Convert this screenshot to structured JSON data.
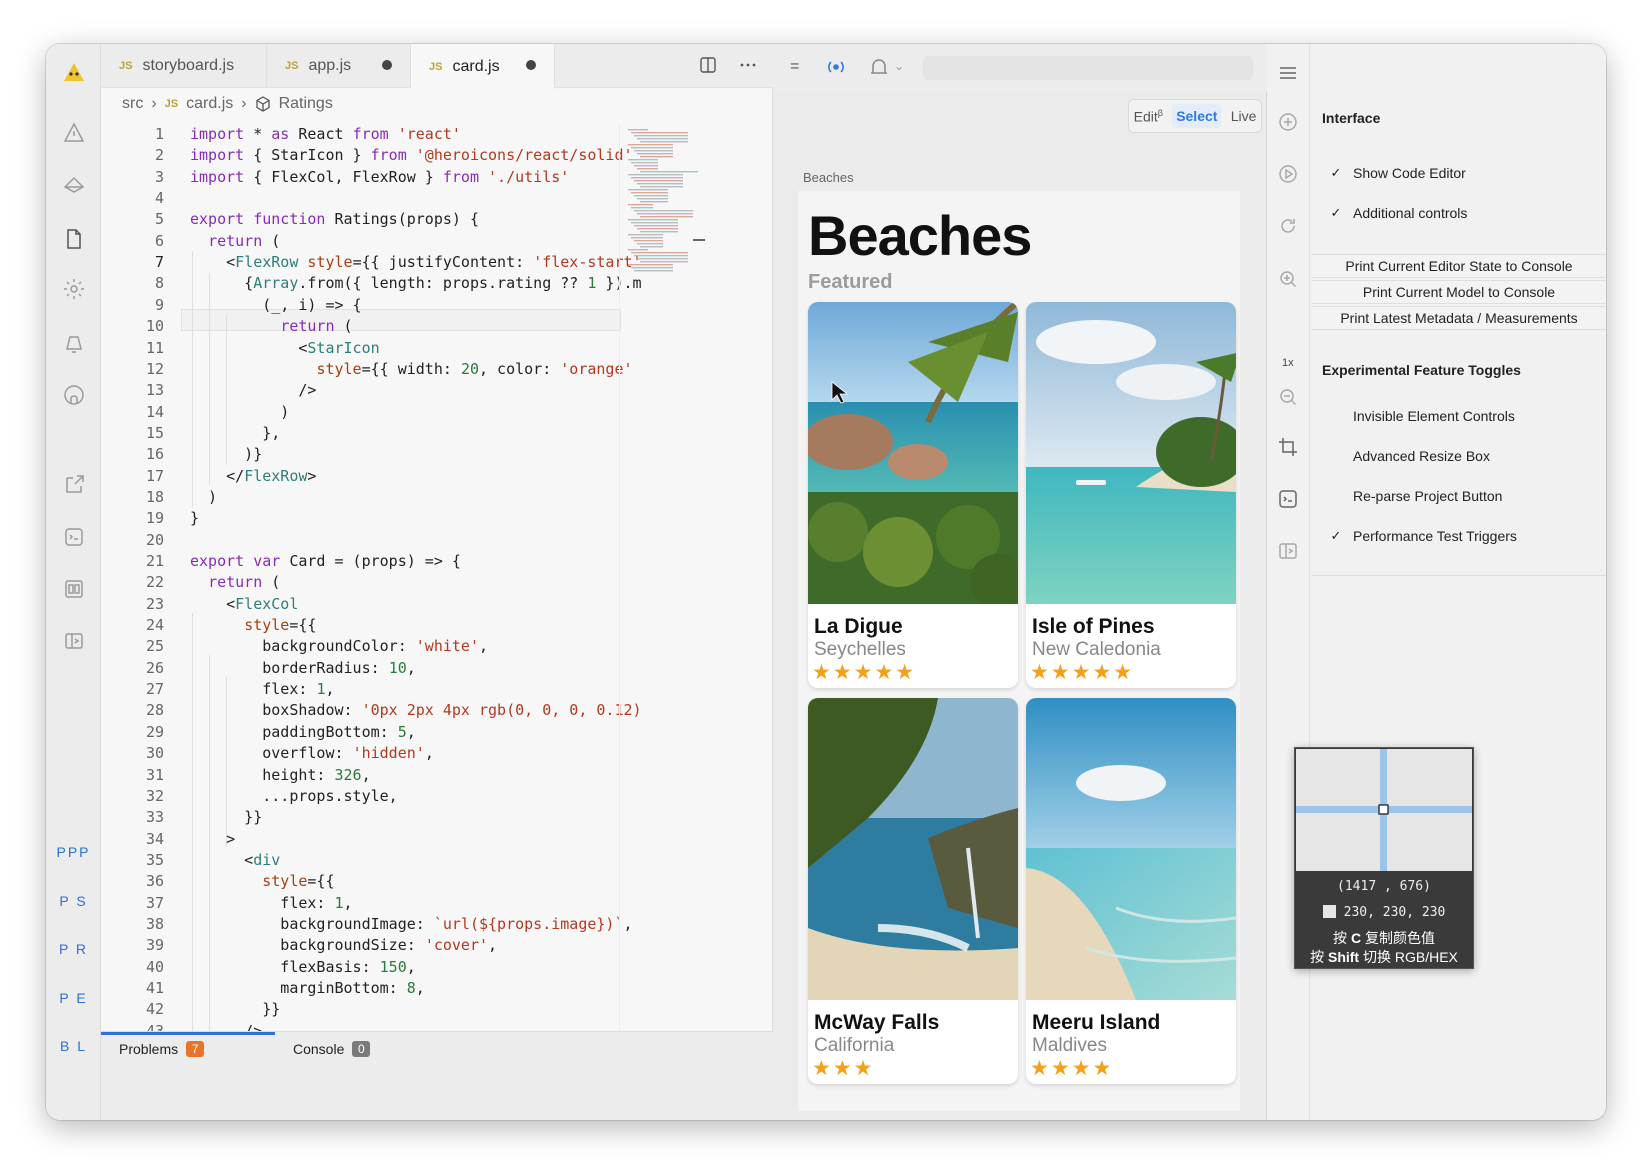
{
  "editor": {
    "tabs": [
      {
        "label": "storyboard.js",
        "badge": "JS",
        "modified": false
      },
      {
        "label": "app.js",
        "badge": "JS",
        "modified": true
      },
      {
        "label": "card.js",
        "badge": "JS",
        "modified": true,
        "active": true
      }
    ],
    "breadcrumb": {
      "folder": "src",
      "file": "card.js",
      "badge": "JS",
      "symbol": "Ratings"
    },
    "lines": [
      [
        [
          "import",
          "kw"
        ],
        [
          " * ",
          ""
        ],
        [
          "as",
          "kw"
        ],
        [
          " React ",
          ""
        ],
        [
          "from",
          "kw"
        ],
        [
          " ",
          ""
        ],
        [
          "'react'",
          "st"
        ]
      ],
      [
        [
          "import",
          "kw"
        ],
        [
          " { StarIcon } ",
          ""
        ],
        [
          "from",
          "kw"
        ],
        [
          " ",
          ""
        ],
        [
          "'@heroicons/react/solid'",
          "st"
        ]
      ],
      [
        [
          "import",
          "kw"
        ],
        [
          " { FlexCol, FlexRow } ",
          ""
        ],
        [
          "from",
          "kw"
        ],
        [
          " ",
          ""
        ],
        [
          "'./utils'",
          "st"
        ]
      ],
      [],
      [
        [
          "export",
          "kw"
        ],
        [
          " ",
          ""
        ],
        [
          "function",
          "kw"
        ],
        [
          " Ratings(props) {",
          ""
        ]
      ],
      [
        [
          "  ",
          ""
        ],
        [
          "return",
          "kw"
        ],
        [
          " (",
          ""
        ]
      ],
      [
        [
          "    <",
          ""
        ],
        [
          "FlexRow",
          "tg"
        ],
        [
          " ",
          ""
        ],
        [
          "style",
          "at"
        ],
        [
          "={{ justifyContent: ",
          ""
        ],
        [
          "'flex-start'",
          "st"
        ]
      ],
      [
        [
          "      {",
          ""
        ],
        [
          "Array",
          "tg"
        ],
        [
          ".from({ length: props.rating ?? ",
          ""
        ],
        [
          "1",
          "nm"
        ],
        [
          " }).m",
          ""
        ]
      ],
      [
        [
          "        (_, i) => {",
          ""
        ]
      ],
      [
        [
          "          ",
          ""
        ],
        [
          "return",
          "kw"
        ],
        [
          " (",
          ""
        ]
      ],
      [
        [
          "            <",
          ""
        ],
        [
          "StarIcon",
          "tg"
        ]
      ],
      [
        [
          "              ",
          ""
        ],
        [
          "style",
          "at"
        ],
        [
          "={{ width: ",
          ""
        ],
        [
          "20",
          "nm"
        ],
        [
          ", color: ",
          ""
        ],
        [
          "'orange'",
          "st"
        ]
      ],
      [
        [
          "            />",
          ""
        ]
      ],
      [
        [
          "          )",
          ""
        ]
      ],
      [
        [
          "        },",
          ""
        ]
      ],
      [
        [
          "      )}",
          ""
        ]
      ],
      [
        [
          "    </",
          ""
        ],
        [
          "FlexRow",
          "tg"
        ],
        [
          ">",
          ""
        ]
      ],
      [
        [
          "  )",
          ""
        ]
      ],
      [
        [
          "}",
          ""
        ]
      ],
      [],
      [
        [
          "export",
          "kw"
        ],
        [
          " ",
          ""
        ],
        [
          "var",
          "kw"
        ],
        [
          " Card = (props) => {",
          ""
        ]
      ],
      [
        [
          "  ",
          ""
        ],
        [
          "return",
          "kw"
        ],
        [
          " (",
          ""
        ]
      ],
      [
        [
          "    <",
          ""
        ],
        [
          "FlexCol",
          "tg"
        ]
      ],
      [
        [
          "      ",
          ""
        ],
        [
          "style",
          "at"
        ],
        [
          "={{",
          ""
        ]
      ],
      [
        [
          "        backgroundColor: ",
          ""
        ],
        [
          "'white'",
          "st"
        ],
        [
          ",",
          ""
        ]
      ],
      [
        [
          "        borderRadius: ",
          ""
        ],
        [
          "10",
          "nm"
        ],
        [
          ",",
          ""
        ]
      ],
      [
        [
          "        flex: ",
          ""
        ],
        [
          "1",
          "nm"
        ],
        [
          ",",
          ""
        ]
      ],
      [
        [
          "        boxShadow: ",
          ""
        ],
        [
          "'0px 2px 4px rgb(0, 0, 0, 0.12)",
          "st"
        ]
      ],
      [
        [
          "        paddingBottom: ",
          ""
        ],
        [
          "5",
          "nm"
        ],
        [
          ",",
          ""
        ]
      ],
      [
        [
          "        overflow: ",
          ""
        ],
        [
          "'hidden'",
          "st"
        ],
        [
          ",",
          ""
        ]
      ],
      [
        [
          "        height: ",
          ""
        ],
        [
          "326",
          "nm"
        ],
        [
          ",",
          ""
        ]
      ],
      [
        [
          "        ...props.style,",
          ""
        ]
      ],
      [
        [
          "      }}",
          ""
        ]
      ],
      [
        [
          "    >",
          ""
        ]
      ],
      [
        [
          "      <",
          ""
        ],
        [
          "div",
          "tg"
        ]
      ],
      [
        [
          "        ",
          ""
        ],
        [
          "style",
          "at"
        ],
        [
          "={{",
          ""
        ]
      ],
      [
        [
          "          flex: ",
          ""
        ],
        [
          "1",
          "nm"
        ],
        [
          ",",
          ""
        ]
      ],
      [
        [
          "          backgroundImage: ",
          ""
        ],
        [
          "`url(${props.image})`",
          "st"
        ],
        [
          ",",
          ""
        ]
      ],
      [
        [
          "          backgroundSize: ",
          ""
        ],
        [
          "'cover'",
          "st"
        ],
        [
          ",",
          ""
        ]
      ],
      [
        [
          "          flexBasis: ",
          ""
        ],
        [
          "150",
          "nm"
        ],
        [
          ",",
          ""
        ]
      ],
      [
        [
          "          marginBottom: ",
          ""
        ],
        [
          "8",
          "nm"
        ],
        [
          ",",
          ""
        ]
      ],
      [
        [
          "        }}",
          ""
        ]
      ],
      [
        [
          "      />",
          ""
        ]
      ]
    ],
    "panel": {
      "problems_label": "Problems",
      "problems_count": "7",
      "console_label": "Console",
      "console_count": "0"
    }
  },
  "activity": {
    "labels": [
      "PPP",
      "P S",
      "P R",
      "P E",
      "B L"
    ]
  },
  "canvas": {
    "modes": {
      "edit": "Edit",
      "edit_sup": "β",
      "select": "Select",
      "live": "Live"
    },
    "scene_label": "Beaches",
    "title": "Beaches",
    "subtitle": "Featured",
    "cards": [
      {
        "name": "La Digue",
        "location": "Seychelles",
        "rating": 5,
        "stars": "★★★★★"
      },
      {
        "name": "Isle of Pines",
        "location": "New Caledonia",
        "rating": 5,
        "stars": "★★★★★"
      },
      {
        "name": "McWay Falls",
        "location": "California",
        "rating": 3,
        "stars": "★★★"
      },
      {
        "name": "Meeru Island",
        "location": "Maldives",
        "rating": 4,
        "stars": "★★★★"
      }
    ]
  },
  "inspector": {
    "heading": "Interface",
    "toggles": [
      {
        "label": "Show Code Editor",
        "checked": true,
        "mark": "✓"
      },
      {
        "label": "Additional controls",
        "checked": true,
        "mark": "✓"
      }
    ],
    "buttons": [
      "Print Current Editor State to Console",
      "Print Current Model to Console",
      "Print Latest Metadata / Measurements"
    ],
    "zoom_label": "1x",
    "experimental_heading": "Experimental Feature Toggles",
    "experimental": [
      {
        "label": "Invisible Element Controls",
        "checked": false,
        "mark": ""
      },
      {
        "label": "Advanced Resize Box",
        "checked": false,
        "mark": ""
      },
      {
        "label": "Re-parse Project Button",
        "checked": false,
        "mark": ""
      },
      {
        "label": "Performance Test Triggers",
        "checked": true,
        "mark": "✓"
      }
    ]
  },
  "picker": {
    "coords": "(1417 , 676)",
    "rgb": "230, 230, 230",
    "hint1_pre": "按 ",
    "hint1_key": "C",
    "hint1_post": " 复制颜色值",
    "hint2_pre": "按 ",
    "hint2_key": "Shift",
    "hint2_post": " 切换 RGB/HEX"
  },
  "colors": {
    "keyword": "#8a2bb8",
    "string": "#b3381f",
    "tag": "#2e7d7a",
    "attr": "#a3410f",
    "number": "#2a7a3a",
    "accent": "#2f7ae5",
    "star": "#f4a01a",
    "problems_badge": "#e8742a",
    "console_badge": "#7a7a7a"
  }
}
